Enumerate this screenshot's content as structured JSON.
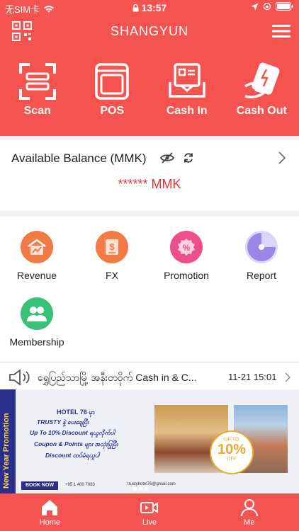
{
  "status_bar": {
    "carrier": "无SIM卡",
    "time": "13:57"
  },
  "header": {
    "title": "SHANGYUN",
    "actions": [
      {
        "label": "Scan",
        "icon": "scan-icon"
      },
      {
        "label": "POS",
        "icon": "pos-icon"
      },
      {
        "label": "Cash In",
        "icon": "cash-in-icon"
      },
      {
        "label": "Cash Out",
        "icon": "cash-out-icon"
      }
    ]
  },
  "balance": {
    "title": "Available Balance (MMK)",
    "amount": "****** MMK"
  },
  "features": [
    {
      "label": "Revenue",
      "icon": "revenue-icon",
      "color": "#f27a45"
    },
    {
      "label": "FX",
      "icon": "fx-icon",
      "color": "#f27a45"
    },
    {
      "label": "Promotion",
      "icon": "promotion-icon",
      "color": "#ee4f8c"
    },
    {
      "label": "Report",
      "icon": "report-icon",
      "color": "#9a86e8"
    },
    {
      "label": "Membership",
      "icon": "membership-icon",
      "color": "#38c179"
    }
  ],
  "news": {
    "text": "ရွှေပြည်သာမြို့ အနီးတဝိုက် Cash in & C...",
    "time": "11-21 15:01"
  },
  "banner": {
    "side_text": "New Year Promotion",
    "hotel": "HOTEL 76 မှာ",
    "lines": [
      "TRUSTY နဲ့ ပေးချေပြီး",
      "Up To 10% Discount ရယူလိုက်ပါ",
      "Coupon & Points များ အသုံးပြုပြီး",
      "Discount ထပ်မံရယူပါ"
    ],
    "book_now": "BOOK NOW",
    "phone": "+95 1 400 7083",
    "email": "trustyhotel76@gmail.com",
    "badge_top": "UP TO",
    "badge_value": "10%",
    "badge_bottom": "OFF"
  },
  "nav": [
    {
      "label": "Home",
      "icon": "home-icon"
    },
    {
      "label": "Live",
      "icon": "live-icon"
    },
    {
      "label": "Me",
      "icon": "me-icon"
    }
  ],
  "colors": {
    "brand": "#f4534f",
    "amount": "#e5352f"
  }
}
